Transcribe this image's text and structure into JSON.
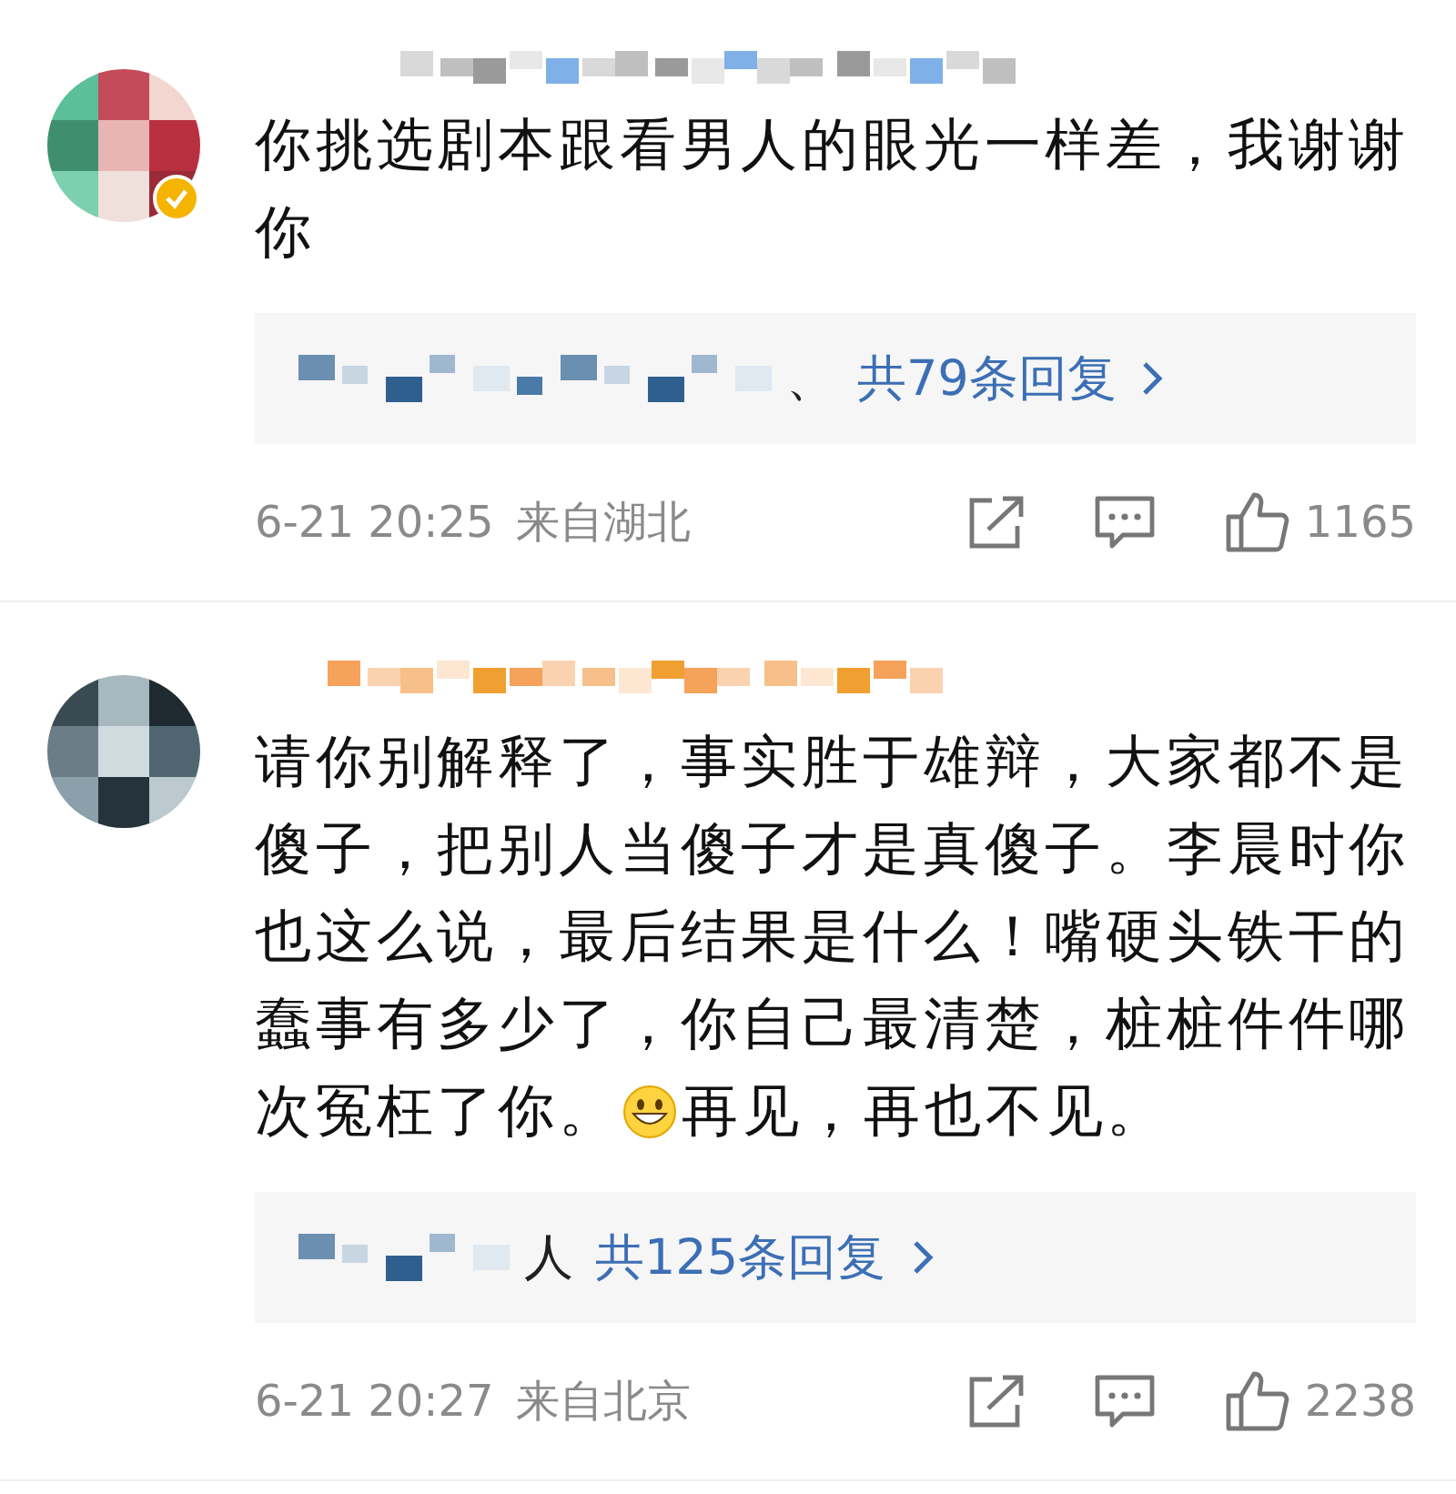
{
  "comments": [
    {
      "verified": true,
      "body": [
        {
          "kind": "text",
          "text": "你挑选剧本跟看男人的眼光一样差，我谢谢你"
        }
      ],
      "replies": {
        "prefix": "、",
        "summary": "共79条回复"
      },
      "time": "6-21 20:25",
      "location": "来自湖北",
      "likes": "1165"
    },
    {
      "verified": false,
      "body": [
        {
          "kind": "text",
          "text": "请你别解释了，事实胜于雄辩，大家都不是傻子，把别人当傻子才是真傻子。李晨时你也这么说，最后结果是什么！嘴硬头铁干的蠢事有多少了，你自己最清楚，桩桩件件哪"
        },
        {
          "kind": "text",
          "text": "次冤枉了你。"
        },
        {
          "kind": "emoji"
        },
        {
          "kind": "text",
          "text": "再见，再也不见。"
        }
      ],
      "replies": {
        "prefix": "人",
        "summary": "共125条回复"
      },
      "time": "6-21 20:27",
      "location": "来自北京",
      "likes": "2238"
    }
  ]
}
